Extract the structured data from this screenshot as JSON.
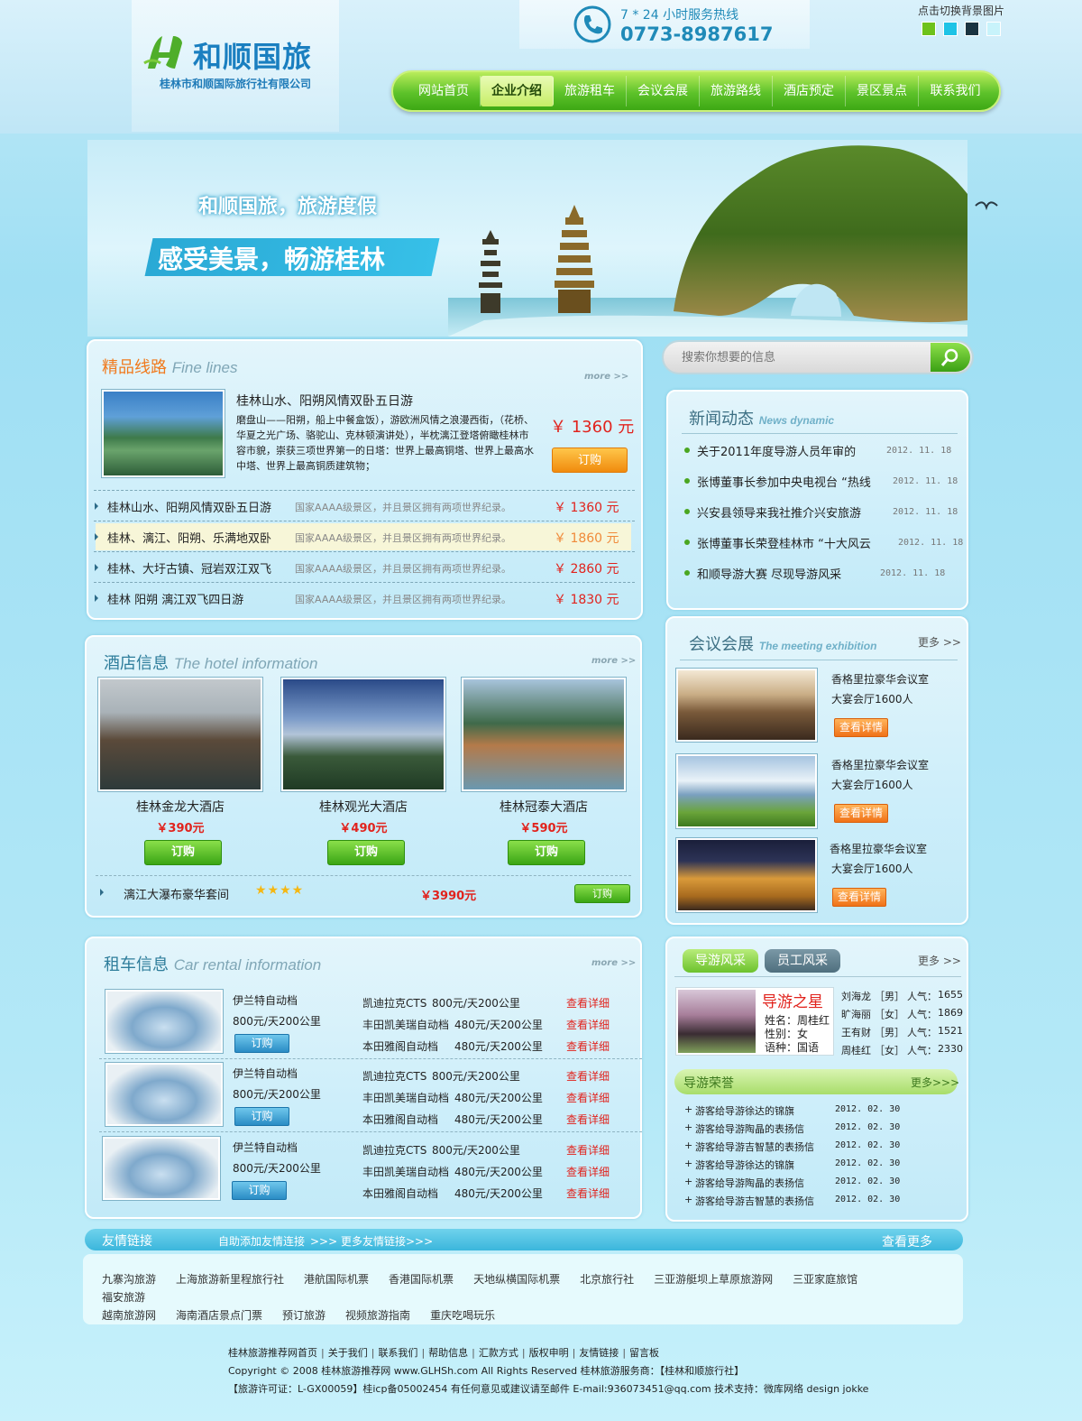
{
  "header": {
    "logo_title": "和顺国旅",
    "logo_subtitle": "桂林市和顺国际旅行社有限公司",
    "hotline_label": "7 * 24 小时服务热线",
    "hotline_number": "0773-8987617",
    "bg_switch_label": "点击切换背景图片",
    "swatch_colors": [
      "#6ec21a",
      "#1ec3e6",
      "#1b3340",
      "#c8f3fb"
    ]
  },
  "nav": {
    "items": [
      "网站首页",
      "企业介绍",
      "旅游租车",
      "会议会展",
      "旅游路线",
      "酒店预定",
      "景区景点",
      "联系我们"
    ],
    "active_index": 1
  },
  "banner": {
    "slogan1": "和顺国旅，旅游度假",
    "slogan2": "感受美景，畅游桂林"
  },
  "search": {
    "placeholder": "搜索你想要的信息"
  },
  "lines": {
    "title_cn": "精品线路",
    "title_en": "Fine lines",
    "more": "more >>",
    "featured": {
      "title": "桂林山水、阳朔风情双卧五日游",
      "desc": "磨盘山——阳朔，船上中餐盒饭），游欧洲风情之浪漫西街，（花桥、华夏之光广场、骆驼山、克林顿演讲处），半枕漓江登塔俯瞰桂林市容市貌，崇获三项世界第一的日塔：世界上最高铜塔、世界上最高水中塔、世界上最高铜质建筑物；",
      "price": "￥ 1360 元",
      "button": "订购"
    },
    "rows": [
      {
        "name": "桂林山水、阳朔风情双卧五日游",
        "desc": "国家AAAA级景区，并且景区拥有两项世界纪录。",
        "price": "￥ 1360 元"
      },
      {
        "name": "桂林、漓江、阳朔、乐满地双卧",
        "desc": "国家AAAA级景区，并且景区拥有两项世界纪录。",
        "price": "￥ 1860 元"
      },
      {
        "name": "桂林、大圩古镇、冠岩双江双飞",
        "desc": "国家AAAA级景区，并且景区拥有两项世界纪录。",
        "price": "￥ 2860 元"
      },
      {
        "name": "桂林 阳朔 漓江双飞四日游",
        "desc": "国家AAAA级景区，并且景区拥有两项世界纪录。",
        "price": "￥ 1830 元"
      }
    ]
  },
  "news": {
    "title_cn": "新闻动态",
    "title_en": "News dynamic",
    "items": [
      {
        "text": "关于2011年度导游人员年审的",
        "date": "2012. 11. 18"
      },
      {
        "text": "张博董事长参加中央电视台 “热线",
        "date": "2012. 11. 18"
      },
      {
        "text": "兴安县领导来我社推介兴安旅游",
        "date": "2012. 11. 18"
      },
      {
        "text": "张博董事长荣登桂林市 “十大风云",
        "date": "2012. 11. 18"
      },
      {
        "text": "和顺导游大赛 尽现导游风采",
        "date": "2012. 11. 18"
      }
    ]
  },
  "hotels": {
    "title_cn": "酒店信息",
    "title_en": "The hotel information",
    "more": "more >>",
    "items": [
      {
        "name": "桂林金龙大酒店",
        "price": "￥390元",
        "button": "订购"
      },
      {
        "name": "桂林观光大酒店",
        "price": "￥490元",
        "button": "订购"
      },
      {
        "name": "桂林冠泰大酒店",
        "price": "￥590元",
        "button": "订购"
      }
    ],
    "suite": {
      "name": "漓江大瀑布豪华套间",
      "stars": 4,
      "price": "￥3990元",
      "button": "订购"
    }
  },
  "meeting": {
    "title_cn": "会议会展",
    "title_en": "The meeting exhibition",
    "more": "更多 >>",
    "items": [
      {
        "name": "香格里拉豪华会议室",
        "desc": "大宴会厅1600人",
        "button": "查看详情"
      },
      {
        "name": "香格里拉豪华会议室",
        "desc": "大宴会厅1600人",
        "button": "查看详情"
      },
      {
        "name": "香格里拉豪华会议室",
        "desc": "大宴会厅1600人",
        "button": "查看详情"
      }
    ]
  },
  "cars": {
    "title_cn": "租车信息",
    "title_en": "Car rental information",
    "more": "more >>",
    "groups": [
      {
        "model": "伊兰特自动档",
        "rate": "800元/天200公里",
        "button": "订购",
        "list": [
          {
            "name": "凯迪拉克CTS",
            "rate": "800元/天200公里",
            "link": "查看详细"
          },
          {
            "name": "丰田凯美瑞自动档",
            "rate": "480元/天200公里",
            "link": "查看详细"
          },
          {
            "name": "本田雅阁自动档",
            "rate": "480元/天200公里",
            "link": "查看详细"
          }
        ]
      },
      {
        "model": "伊兰特自动档",
        "rate": "800元/天200公里",
        "button": "订购",
        "list": [
          {
            "name": "凯迪拉克CTS",
            "rate": "800元/天200公里",
            "link": "查看详细"
          },
          {
            "name": "丰田凯美瑞自动档",
            "rate": "480元/天200公里",
            "link": "查看详细"
          },
          {
            "name": "本田雅阁自动档",
            "rate": "480元/天200公里",
            "link": "查看详细"
          }
        ]
      },
      {
        "model": "伊兰特自动档",
        "rate": "800元/天200公里",
        "button": "订购",
        "list": [
          {
            "name": "凯迪拉克CTS",
            "rate": "800元/天200公里",
            "link": "查看详细"
          },
          {
            "name": "丰田凯美瑞自动档",
            "rate": "480元/天200公里",
            "link": "查看详细"
          },
          {
            "name": "本田雅阁自动档",
            "rate": "480元/天200公里",
            "link": "查看详细"
          }
        ]
      }
    ]
  },
  "guides": {
    "tab_active": "导游风采",
    "tab_inactive": "员工风采",
    "more": "更多 >>",
    "star_label": "导游之星",
    "star_name": "姓名：周桂红",
    "star_gender": "性别：女",
    "star_language": "语种：国语",
    "ranking": [
      {
        "name": "刘海龙",
        "gender": "［男］",
        "label": "人气：",
        "value": "1655"
      },
      {
        "name": "旷海丽",
        "gender": "［女］",
        "label": "人气：",
        "value": "1869"
      },
      {
        "name": "王有财",
        "gender": "［男］",
        "label": "人气：",
        "value": "1521"
      },
      {
        "name": "周桂红",
        "gender": "［女］",
        "label": "人气：",
        "value": "2330"
      }
    ],
    "honor_title": "导游荣誉",
    "honor_more": "更多>>>",
    "honors": [
      {
        "text": "游客给导游徐达的锦旗",
        "date": "2012. 02. 30"
      },
      {
        "text": "游客给导游陶晶的表扬信",
        "date": "2012. 02. 30"
      },
      {
        "text": "游客给导游吉智慧的表扬信",
        "date": "2012. 02. 30"
      },
      {
        "text": "游客给导游徐达的锦旗",
        "date": "2012. 02. 30"
      },
      {
        "text": "游客给导游陶晶的表扬信",
        "date": "2012. 02. 30"
      },
      {
        "text": "游客给导游吉智慧的表扬信",
        "date": "2012. 02. 30"
      }
    ]
  },
  "links": {
    "title": "友情链接",
    "add": "自助添加友情连接",
    "more_links": ">>> 更多友情链接>>>",
    "view_more": "查看更多",
    "items": [
      "九寨沟旅游",
      "上海旅游新里程旅行社",
      "港航国际机票",
      "香港国际机票",
      "天地纵横国际机票",
      "北京旅行社",
      "三亚游艇坝上草原旅游网",
      "三亚家庭旅馆",
      "福安旅游",
      "越南旅游网",
      "海南酒店景点门票",
      "预订旅游",
      "视频旅游指南",
      "重庆吃喝玩乐"
    ]
  },
  "footer": {
    "nav": [
      "桂林旅游推荐网首页",
      "关于我们",
      "联系我们",
      "帮助信息",
      "汇款方式",
      "版权申明",
      "友情链接",
      "留言板"
    ],
    "copyright": "Copyright © 2008 桂林旅游推荐网 www.GLHSh.com All Rights Reserved 桂林旅游服务商：【桂林和顺旅行社】",
    "license": "【旅游许可证：L-GX00059】桂icp备05002454 有任何意见或建议请至邮件 E-mail:936073451@qq.com 技术支持：微库网络 design jokke"
  }
}
